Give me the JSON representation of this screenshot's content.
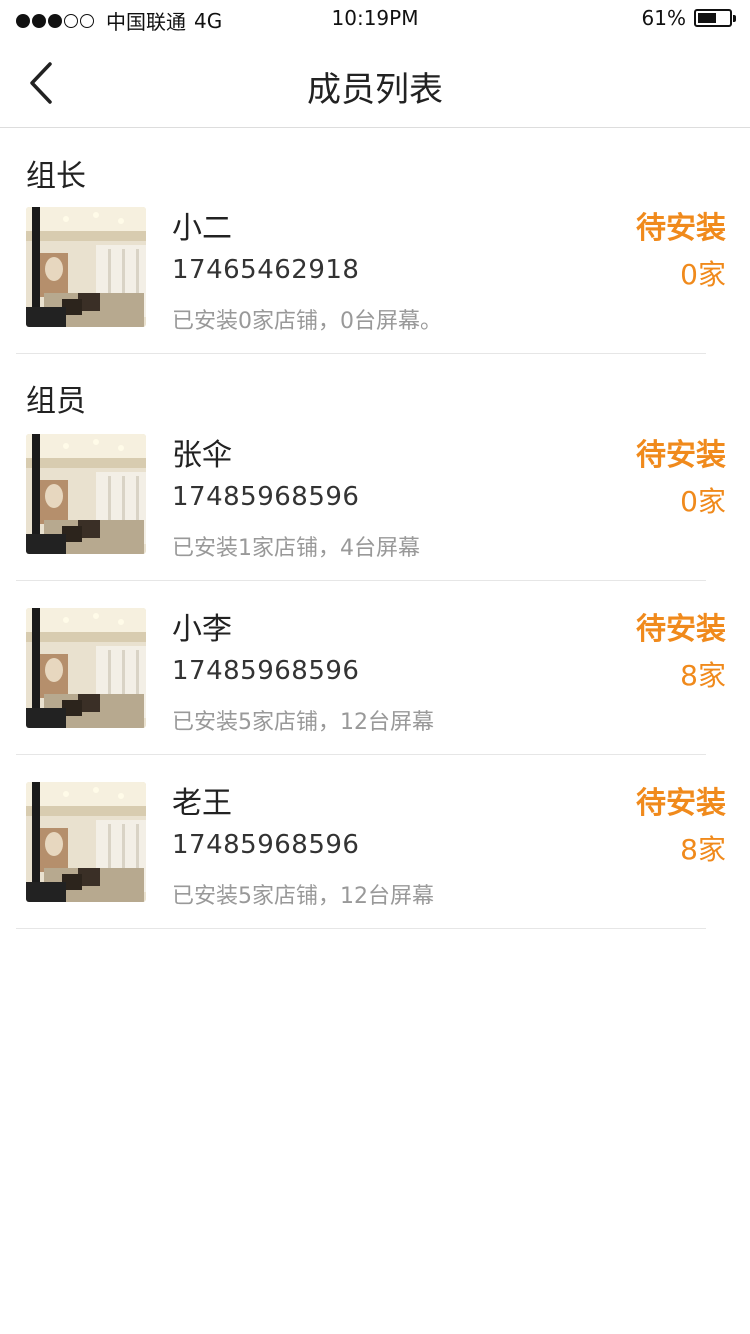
{
  "status_bar": {
    "carrier": "中国联通",
    "network": "4G",
    "time": "10:19PM",
    "battery_percent": "61%",
    "battery_level": 0.61,
    "signal_bars_filled": 3,
    "signal_bars_total": 5
  },
  "nav": {
    "title": "成员列表",
    "back_icon": "chevron-left-icon"
  },
  "colors": {
    "accent": "#f08a1c",
    "text_primary": "#222222",
    "text_secondary": "#999999",
    "divider": "#e6e6e6"
  },
  "sections": [
    {
      "title": "组长",
      "members": [
        {
          "name": "小二",
          "phone": "17465462918",
          "summary": "已安装0家店铺，0台屏幕。",
          "status": "待安装",
          "count": "0家"
        }
      ]
    },
    {
      "title": "组员",
      "members": [
        {
          "name": "张伞",
          "phone": "17485968596",
          "summary": "已安装1家店铺，4台屏幕",
          "status": "待安装",
          "count": "0家"
        },
        {
          "name": "小李",
          "phone": "17485968596",
          "summary": "已安装5家店铺，12台屏幕",
          "status": "待安装",
          "count": "8家"
        },
        {
          "name": "老王",
          "phone": "17485968596",
          "summary": "已安装5家店铺，12台屏幕",
          "status": "待安装",
          "count": "8家"
        }
      ]
    }
  ]
}
